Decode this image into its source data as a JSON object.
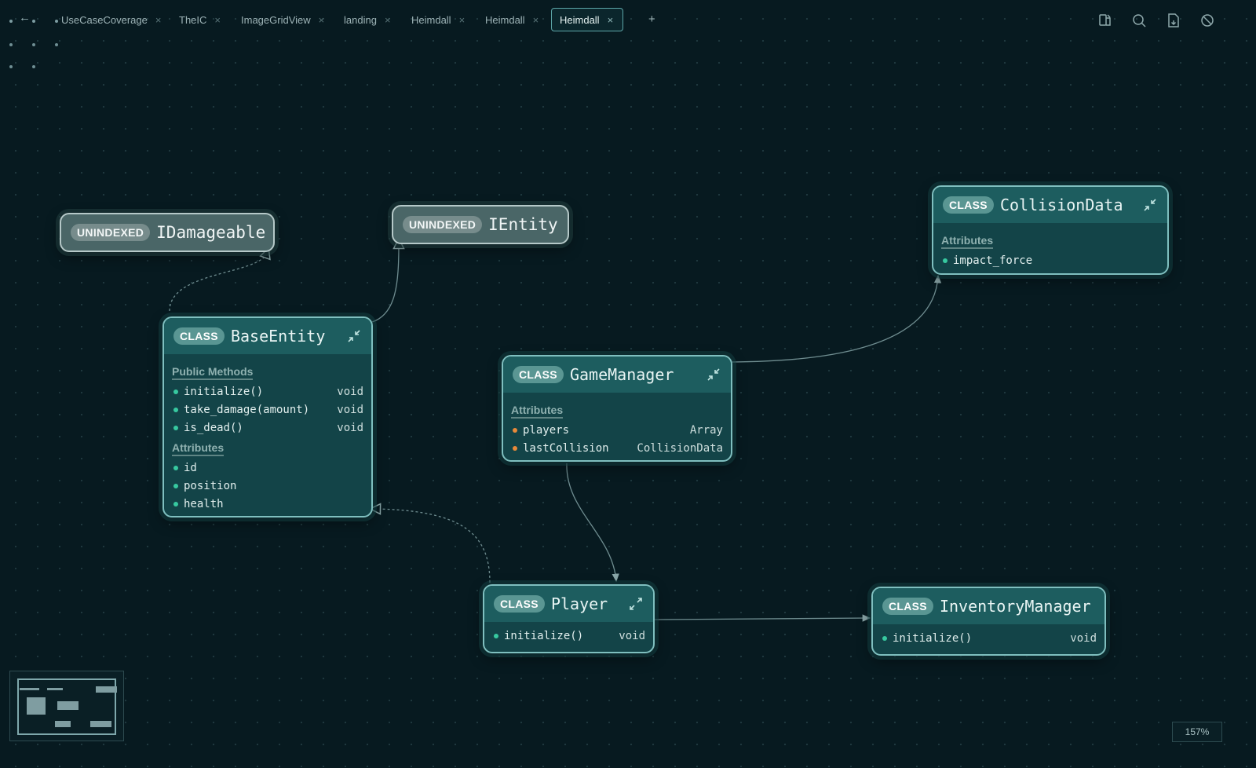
{
  "tabs": [
    {
      "label": "UseCaseCoverage",
      "active": false
    },
    {
      "label": "TheIC",
      "active": false
    },
    {
      "label": "ImageGridView",
      "active": false
    },
    {
      "label": "landing",
      "active": false
    },
    {
      "label": "Heimdall",
      "active": false
    },
    {
      "label": "Heimdall",
      "active": false
    },
    {
      "label": "Heimdall",
      "active": true
    }
  ],
  "add_tab_label": "+",
  "back_label": "←",
  "toolbar_icons": [
    "layout-icon",
    "search-icon",
    "export-icon",
    "block-icon"
  ],
  "nodes": {
    "idamageable": {
      "badge": "UNINDEXED",
      "title": "IDamageable"
    },
    "ientity": {
      "badge": "UNINDEXED",
      "title": "IEntity"
    },
    "collisiondata": {
      "badge": "CLASS",
      "title": "CollisionData",
      "sections": [
        {
          "title": "Attributes",
          "rows": [
            {
              "name": "impact_force",
              "type": "",
              "dot": "green"
            }
          ]
        }
      ]
    },
    "baseentity": {
      "badge": "CLASS",
      "title": "BaseEntity",
      "sections": [
        {
          "title": "Public Methods",
          "rows": [
            {
              "name": "initialize()",
              "type": "void",
              "dot": "green"
            },
            {
              "name": "take_damage(amount)",
              "type": "void",
              "dot": "green"
            },
            {
              "name": "is_dead()",
              "type": "void",
              "dot": "green"
            }
          ]
        },
        {
          "title": "Attributes",
          "rows": [
            {
              "name": "id",
              "type": "",
              "dot": "green"
            },
            {
              "name": "position",
              "type": "",
              "dot": "green"
            },
            {
              "name": "health",
              "type": "",
              "dot": "green"
            }
          ]
        }
      ]
    },
    "gamemanager": {
      "badge": "CLASS",
      "title": "GameManager",
      "sections": [
        {
          "title": "Attributes",
          "rows": [
            {
              "name": "players",
              "type": "Array",
              "dot": "orange"
            },
            {
              "name": "lastCollision",
              "type": "CollisionData",
              "dot": "orange"
            }
          ]
        }
      ]
    },
    "player": {
      "badge": "CLASS",
      "title": "Player",
      "rows": [
        {
          "name": "initialize()",
          "type": "void",
          "dot": "green"
        }
      ]
    },
    "inventorymanager": {
      "badge": "CLASS",
      "title": "InventoryManager",
      "rows": [
        {
          "name": "initialize()",
          "type": "void",
          "dot": "green"
        }
      ]
    }
  },
  "zoom_label": "157%",
  "colors": {
    "background": "#071a20",
    "node": "#134448",
    "node_header": "#1d5d5f",
    "accent": "#7fbfbf",
    "method_dot": "#37c9a0",
    "field_dot": "#e8893a"
  }
}
